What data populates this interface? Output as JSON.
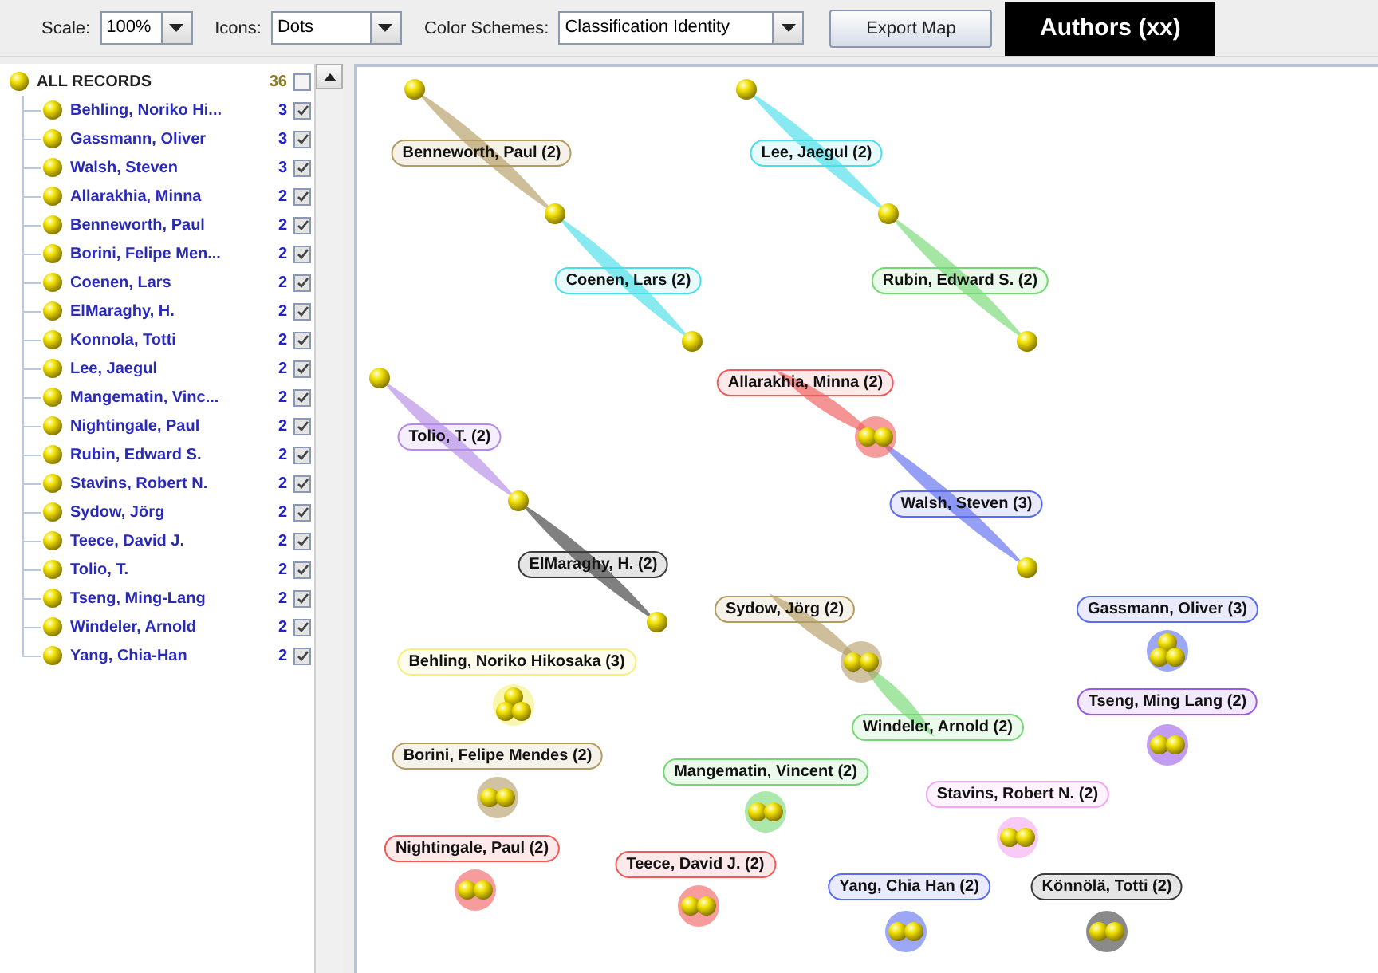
{
  "toolbar": {
    "scale": {
      "label": "Scale:",
      "value": "100%"
    },
    "icons": {
      "label": "Icons:",
      "value": "Dots"
    },
    "color_schemes": {
      "label": "Color Schemes:",
      "value": "Classification Identity"
    },
    "export_button": "Export Map",
    "title": "Authors (xx)"
  },
  "sidebar": {
    "root": {
      "label": "ALL RECORDS",
      "count": "36",
      "checked": false,
      "children": [
        {
          "label": "Behling, Noriko Hi...",
          "count": "3",
          "checked": true
        },
        {
          "label": "Gassmann, Oliver",
          "count": "3",
          "checked": true
        },
        {
          "label": "Walsh, Steven",
          "count": "3",
          "checked": true
        },
        {
          "label": "Allarakhia, Minna",
          "count": "2",
          "checked": true
        },
        {
          "label": "Benneworth, Paul",
          "count": "2",
          "checked": true
        },
        {
          "label": "Borini, Felipe Men...",
          "count": "2",
          "checked": true
        },
        {
          "label": "Coenen, Lars",
          "count": "2",
          "checked": true
        },
        {
          "label": "ElMaraghy, H.",
          "count": "2",
          "checked": true
        },
        {
          "label": "Konnola, Totti",
          "count": "2",
          "checked": true
        },
        {
          "label": "Lee, Jaegul",
          "count": "2",
          "checked": true
        },
        {
          "label": "Mangematin, Vinc...",
          "count": "2",
          "checked": true
        },
        {
          "label": "Nightingale, Paul",
          "count": "2",
          "checked": true
        },
        {
          "label": "Rubin, Edward S.",
          "count": "2",
          "checked": true
        },
        {
          "label": "Stavins, Robert N.",
          "count": "2",
          "checked": true
        },
        {
          "label": "Sydow, Jörg",
          "count": "2",
          "checked": true
        },
        {
          "label": "Teece, David J.",
          "count": "2",
          "checked": true
        },
        {
          "label": "Tolio, T.",
          "count": "2",
          "checked": true
        },
        {
          "label": "Tseng, Ming-Lang",
          "count": "2",
          "checked": true
        },
        {
          "label": "Windeler, Arnold",
          "count": "2",
          "checked": true
        },
        {
          "label": "Yang, Chia-Han",
          "count": "2",
          "checked": true
        }
      ]
    }
  },
  "map": {
    "nodes": [
      {
        "label": "Benneworth, Paul (2)",
        "color": "#b39b62"
      },
      {
        "label": "Lee, Jaegul (2)",
        "color": "#48dfe8"
      },
      {
        "label": "Coenen, Lars (2)",
        "color": "#48dfe8"
      },
      {
        "label": "Rubin, Edward S. (2)",
        "color": "#74d874"
      },
      {
        "label": "Allarakhia, Minna (2)",
        "color": "#f05a5a"
      },
      {
        "label": "Tolio, T. (2)",
        "color": "#b48ae6"
      },
      {
        "label": "Walsh, Steven (3)",
        "color": "#5a6cf0"
      },
      {
        "label": "ElMaraghy, H. (2)",
        "color": "#3c3c3c"
      },
      {
        "label": "Sydow, Jörg (2)",
        "color": "#b39b62"
      },
      {
        "label": "Gassmann, Oliver (3)",
        "color": "#5a6cf0"
      },
      {
        "label": "Behling, Noriko Hikosaka (3)",
        "color": "#f4f07a"
      },
      {
        "label": "Tseng, Ming Lang (2)",
        "color": "#9a5ae6"
      },
      {
        "label": "Windeler, Arnold (2)",
        "color": "#74d874"
      },
      {
        "label": "Borini, Felipe Mendes (2)",
        "color": "#b39b62"
      },
      {
        "label": "Mangematin, Vincent (2)",
        "color": "#74d874"
      },
      {
        "label": "Stavins, Robert N. (2)",
        "color": "#f4a6f4"
      },
      {
        "label": "Nightingale, Paul (2)",
        "color": "#f05a5a"
      },
      {
        "label": "Teece, David J. (2)",
        "color": "#f05a5a"
      },
      {
        "label": "Yang, Chia Han (2)",
        "color": "#5a6cf0"
      },
      {
        "label": "Könnölä, Totti (2)",
        "color": "#3c3c3c"
      }
    ]
  }
}
